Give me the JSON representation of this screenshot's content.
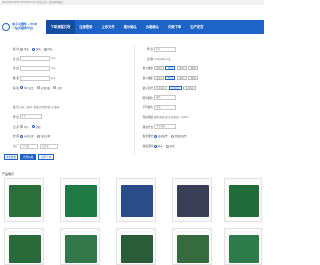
{
  "topbar": {
    "text": "400-XXX-XXXX  XXX@XX.com  提交日志 | 成功案例展示"
  },
  "logo": {
    "line1": "电子元器件 · PCB",
    "line2": "一站式服务平台"
  },
  "nav": {
    "items": [
      "下单流程引导",
      "注册登录",
      "上传文件",
      "报价确认",
      "价格确认",
      "付款下单",
      "生产发货"
    ],
    "active": 0
  },
  "form": {
    "left": [
      {
        "label": "板 材",
        "type": "radio",
        "options": [
          "单面",
          "双面",
          "四层"
        ],
        "selected": 1
      },
      {
        "label": "长 度",
        "type": "input",
        "value": "",
        "unit": "mm"
      },
      {
        "label": "宽 度",
        "type": "input",
        "value": "",
        "unit": "mm"
      },
      {
        "label": "数 量",
        "type": "input",
        "value": "",
        "unit": "pcs"
      },
      {
        "label": "拼 版",
        "type": "radio",
        "options": [
          "单片出货",
          "无需拼板",
          "合拼"
        ],
        "selected": 0
      },
      {
        "label": "",
        "type": "spacer"
      },
      {
        "label": "备 注",
        "type": "text",
        "value": "如有（说明：要求过孔等特殊工艺要求）"
      },
      {
        "label": "厚 度",
        "type": "select",
        "value": "1.6"
      },
      {
        "label": "出 货",
        "type": "radio",
        "options": [
          "单片",
          "拼版"
        ],
        "selected": 1
      },
      {
        "label": "交 期",
        "type": "radio",
        "options": [
          "标准交期",
          "加急交期"
        ],
        "selected": 0
      },
      {
        "label": "出 厂",
        "type": "selects",
        "values": [
          "广东省",
          "东莞市"
        ]
      }
    ],
    "right": [
      {
        "label": "厚 度",
        "type": "select",
        "value": "1.6"
      },
      {
        "label": "层 数",
        "type": "text",
        "value": "Complete 不含"
      },
      {
        "label": "最小线宽",
        "type": "chips",
        "options": [
          "4mil",
          "5mil",
          "6mil",
          "8mil"
        ],
        "selected": 1
      },
      {
        "label": "最小线距",
        "type": "chips",
        "options": [
          "4mil",
          "5mil",
          "6mil",
          "8mil"
        ],
        "selected": 1
      },
      {
        "label": "最小孔径",
        "type": "chips",
        "options": [
          "0.2mm",
          "0.3mm",
          "0.4mm"
        ],
        "selected": 1
      },
      {
        "label": "阻焊颜色",
        "type": "select",
        "value": "绿色"
      },
      {
        "label": "字符颜色",
        "type": "select",
        "value": "白色"
      },
      {
        "label": "焊盘喷镀",
        "type": "text",
        "value": "喷锡(有铅)金(沉金/镀金)…0.8um"
      },
      {
        "label": "测试方式",
        "type": "select",
        "value": "飞针测试"
      },
      {
        "label": "发票类型",
        "type": "radio",
        "options": [
          "普通发票",
          "增值税发票"
        ],
        "selected": 0
      },
      {
        "label": "快递选择",
        "type": "radio",
        "options": [
          "顺丰",
          "其他"
        ],
        "selected": 0
      }
    ]
  },
  "buttons": {
    "reset": "重置数据",
    "calc": "计算价格",
    "order": "立即下单"
  },
  "showcase": {
    "title": "产品展示"
  },
  "colors": {
    "brand": "#1e64c8"
  }
}
